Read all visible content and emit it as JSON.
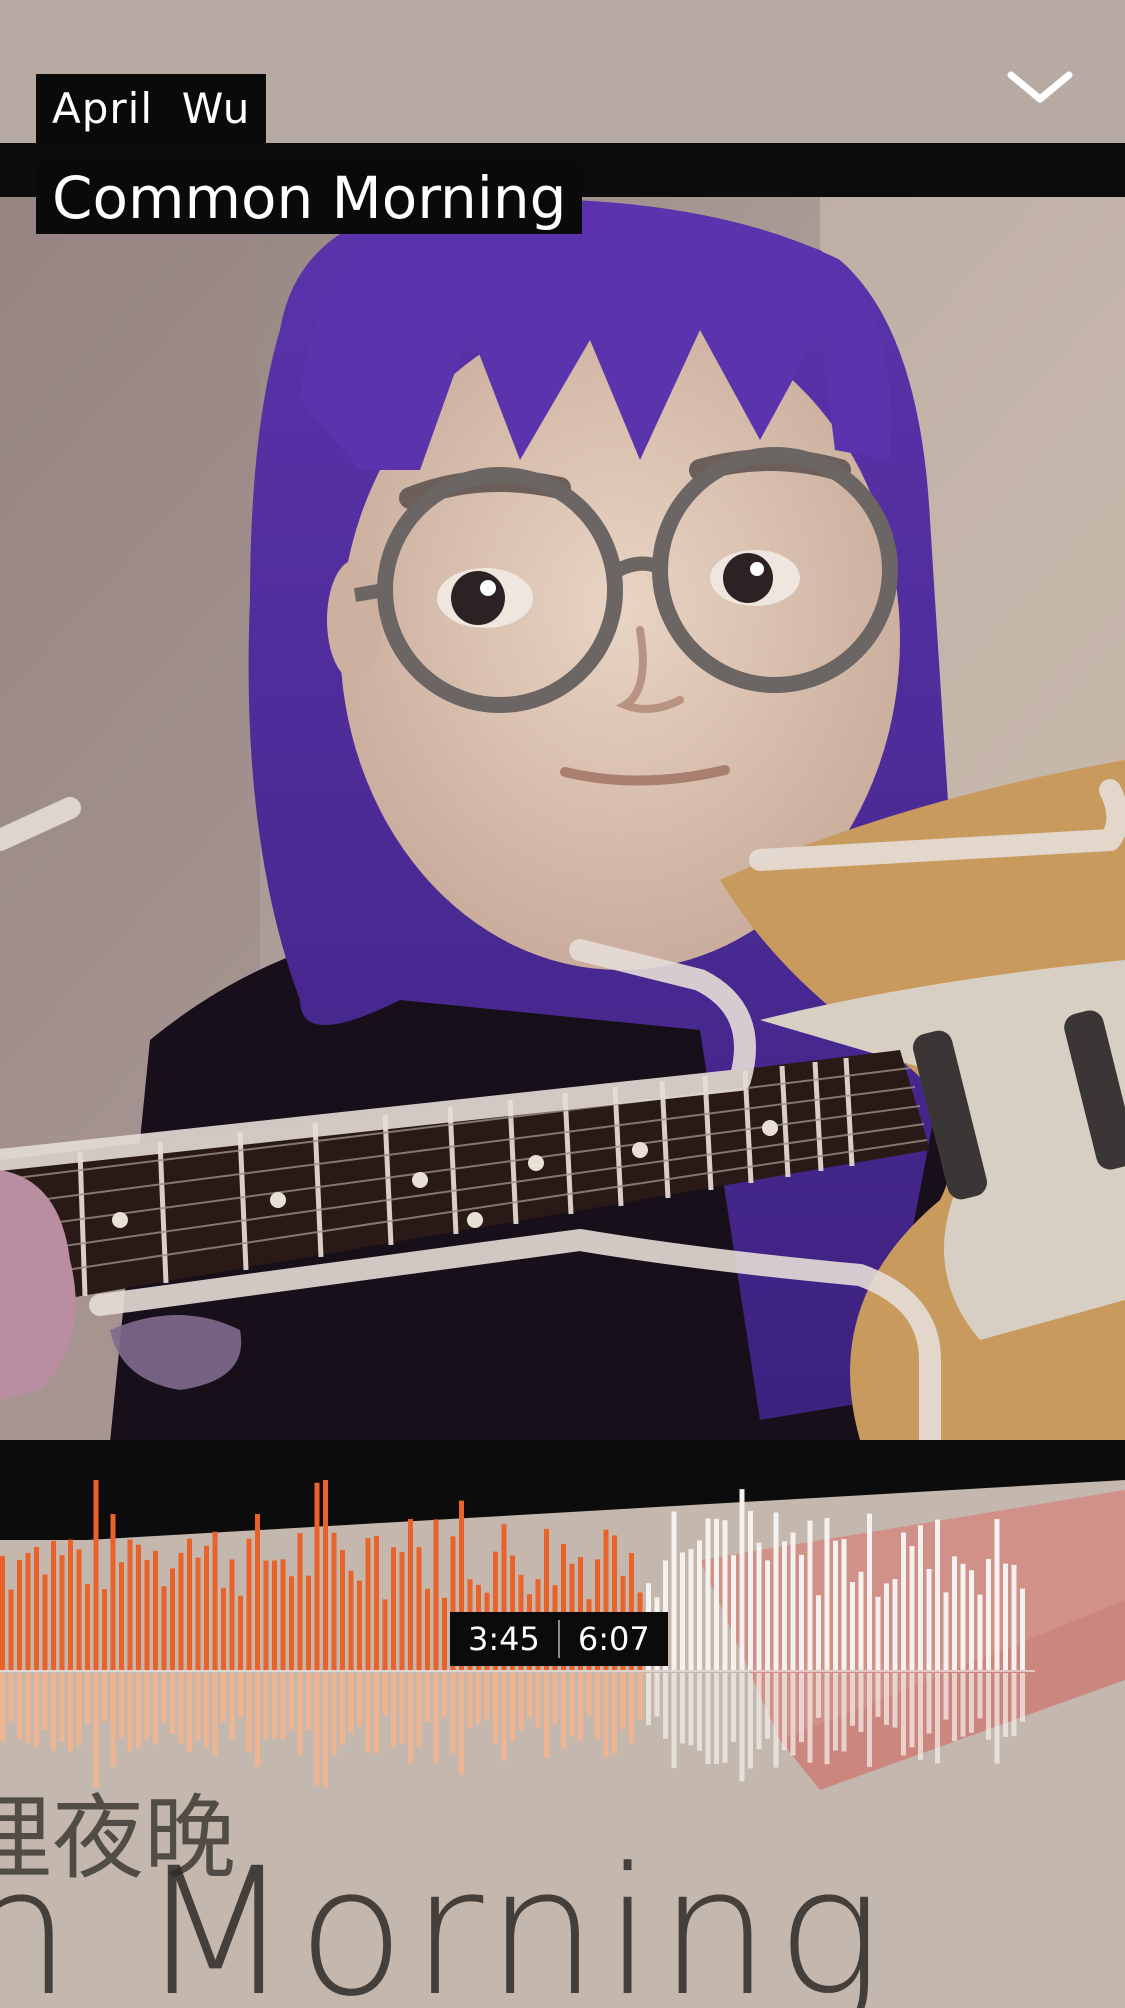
{
  "player": {
    "artist": "April  Wu",
    "title": "Common Morning",
    "collapse_icon": "chevron-down-icon",
    "elapsed": "3:45",
    "duration": "6:07",
    "progress": 0.618
  },
  "cover_text": {
    "cjk": "浬夜晚",
    "english": "n Morning"
  },
  "colors": {
    "played": "#e8622a",
    "played_reflection": "#f2b48e",
    "unplayed": "#f5f1ee",
    "hair": "#5a33a8"
  }
}
